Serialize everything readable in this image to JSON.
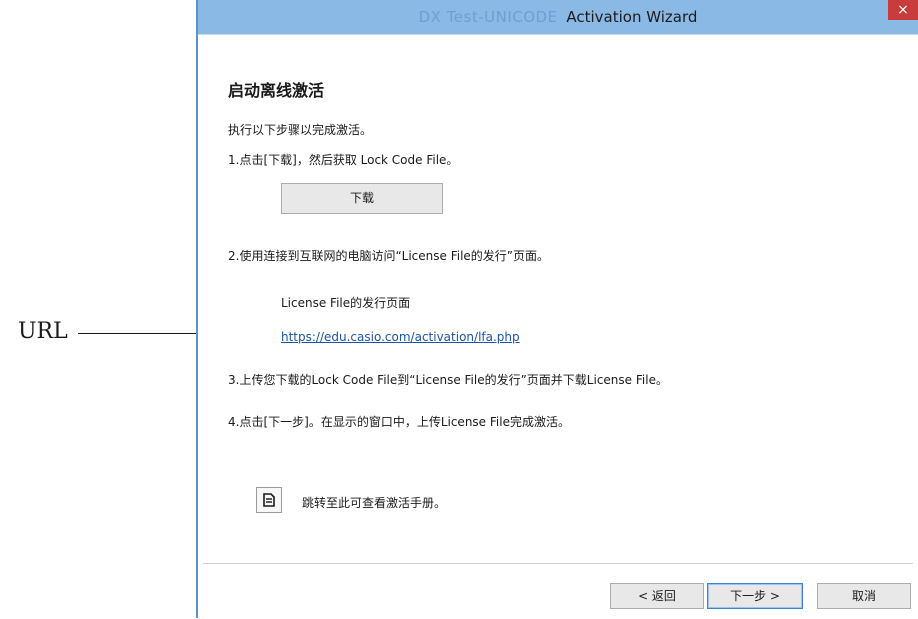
{
  "annotation": {
    "label": "URL"
  },
  "window": {
    "title_prefix": "DX Test-UNICODE",
    "title": "Activation Wizard",
    "close_symbol": "×",
    "close_icon": "close-icon"
  },
  "content": {
    "heading": "启动离线激活",
    "intro": "执行以下步骤以完成激活。",
    "step1": "1.点击[下载]，然后获取 Lock Code File。",
    "download_label": "下载",
    "step2": "2.使用连接到互联网的电脑访问“License File的发行”页面。",
    "license_page_title": "License File的发行页面",
    "license_url": "https://edu.casio.com/activation/lfa.php",
    "step3": "3.上传您下载的Lock Code File到“License File的发行”页面并下载License File。",
    "step4": "4.点击[下一步]。在显示的窗口中，上传License File完成激活。",
    "manual_icon": "document-icon",
    "manual_text": "跳转至此可查看激活手册。"
  },
  "footer": {
    "back_label": "< 返回",
    "next_label": "下一步 >",
    "cancel_label": "取消"
  },
  "colors": {
    "titlebar": "#8ab9e6",
    "close": "#c83c3c",
    "link": "#1a55a8"
  }
}
